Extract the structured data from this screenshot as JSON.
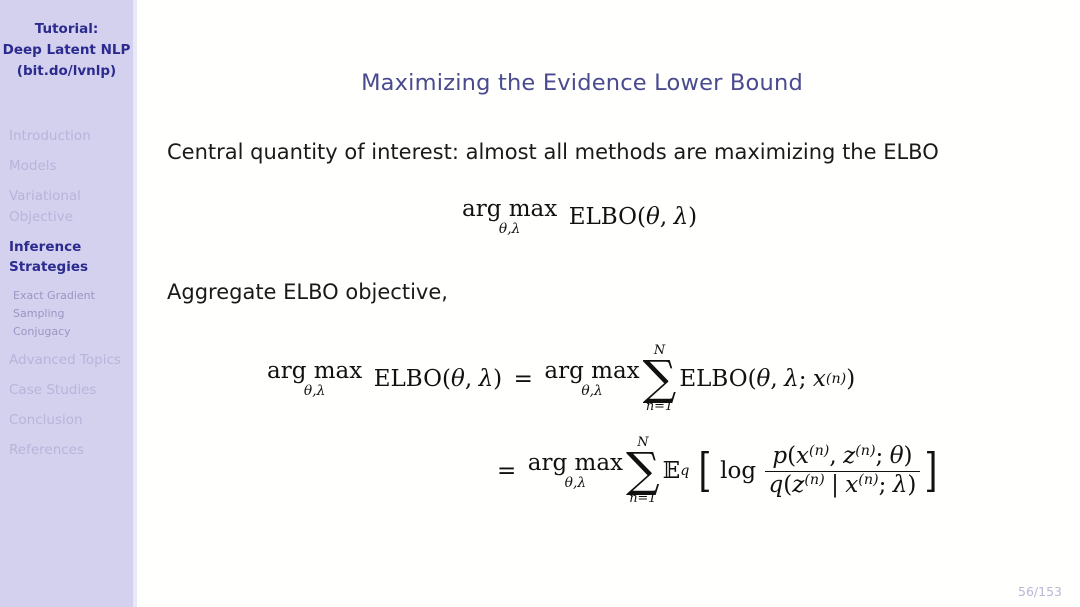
{
  "sidebar": {
    "header_lines": [
      "Tutorial:",
      "Deep Latent NLP",
      "(bit.do/lvnlp)"
    ],
    "items": [
      {
        "label": "Introduction",
        "level": "top",
        "active": false
      },
      {
        "label": "Models",
        "level": "top",
        "active": false
      },
      {
        "label": "Variational",
        "level": "top",
        "active": false
      },
      {
        "label": "Objective",
        "level": "top",
        "active": false
      },
      {
        "label": "Inference",
        "level": "top",
        "active": true
      },
      {
        "label": "Strategies",
        "level": "top",
        "active": true
      },
      {
        "label": "Exact Gradient",
        "level": "sub",
        "active": false
      },
      {
        "label": "Sampling",
        "level": "sub",
        "active": false
      },
      {
        "label": "Conjugacy",
        "level": "sub",
        "active": false
      },
      {
        "label": "Advanced Topics",
        "level": "top",
        "active": false
      },
      {
        "label": "Case Studies",
        "level": "top",
        "active": false
      },
      {
        "label": "Conclusion",
        "level": "top",
        "active": false
      },
      {
        "label": "References",
        "level": "top",
        "active": false
      }
    ]
  },
  "slide": {
    "title": "Maximizing the Evidence Lower Bound",
    "body_line_1": "Central quantity of interest: almost all methods are maximizing the ELBO",
    "body_line_2": "Aggregate ELBO objective,",
    "page_number": "56/153"
  },
  "math": {
    "argmax": "arg max",
    "limits": "θ,λ",
    "elbo": "ELBO",
    "paren_open": "(",
    "paren_close": ")",
    "theta": "θ",
    "lambda": "λ",
    "comma": ",",
    "semicolon": ";",
    "equals": "=",
    "sigma": "∑",
    "sum_upper": "N",
    "sum_lower": "n=1",
    "expectation": "𝔼",
    "expectation_sub": "q",
    "log": "log",
    "x": "x",
    "z": "z",
    "p": "p",
    "q": "q",
    "superscript_n": "(n)",
    "mid": "|",
    "bracket_open": "[",
    "bracket_close": "]",
    "eq1_text": "arg max_{θ,λ} ELBO(θ, λ)",
    "eq2_text": "arg max_{θ,λ} ELBO(θ, λ) = arg max_{θ,λ} Σ_{n=1}^{N} ELBO(θ, λ; x^(n))",
    "eq3_text": "= arg max_{θ,λ} Σ_{n=1}^{N} E_q [ log p(x^(n), z^(n); θ) / q(z^(n) | x^(n); λ) ]"
  },
  "colors": {
    "sidebar_bg": "#d4d1ef",
    "sidebar_active": "#2b2b8f",
    "sidebar_inactive": "#b7b4da",
    "sidebar_sub": "#9996c4",
    "title": "#4a4a8f",
    "body_text": "#1a1a1a",
    "page_number": "#b9b6d6",
    "background": "#fffffd"
  }
}
